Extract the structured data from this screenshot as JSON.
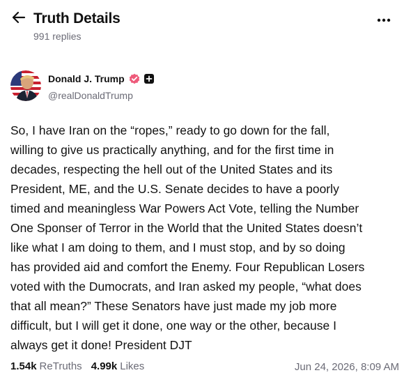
{
  "header": {
    "title": "Truth Details",
    "replies": "991 replies",
    "back_icon": "arrow-left-icon",
    "more_icon": "more-horizontal-icon"
  },
  "author": {
    "name": "Donald J. Trump",
    "handle": "@realDonaldTrump",
    "verified_icon": "verified-badge-icon",
    "verified_color": "#ee5a7a",
    "plus_icon": "plus-badge-icon"
  },
  "post": {
    "lines": [
      "So, I have Iran on the “ropes,” ready to go down for the fall,",
      "willing to give us practically anything, and for the first time in",
      "decades, respecting the hell out of the United States and its",
      "President, ME, and the U.S. Senate decides to have a poorly",
      "timed and meaningless War Powers Act Vote, telling the Number",
      "One Sponser of Terror in the World that the United States doesn’t",
      "like what I am doing to them, and I must stop, and by so doing",
      "has provided aid and comfort the Enemy. Four Republican Losers",
      "voted with the Dumocrats, and Iran asked my people, “what does",
      "that all mean?” These Senators have just made my job more",
      "difficult, but I will get it done, one way or the other, because I",
      "always get it done! President DJT"
    ]
  },
  "stats": {
    "retruths_count": "1.54k",
    "retruths_label": "ReTruths",
    "likes_count": "4.99k",
    "likes_label": "Likes",
    "timestamp": "Jun 24, 2026, 8:09 AM"
  }
}
